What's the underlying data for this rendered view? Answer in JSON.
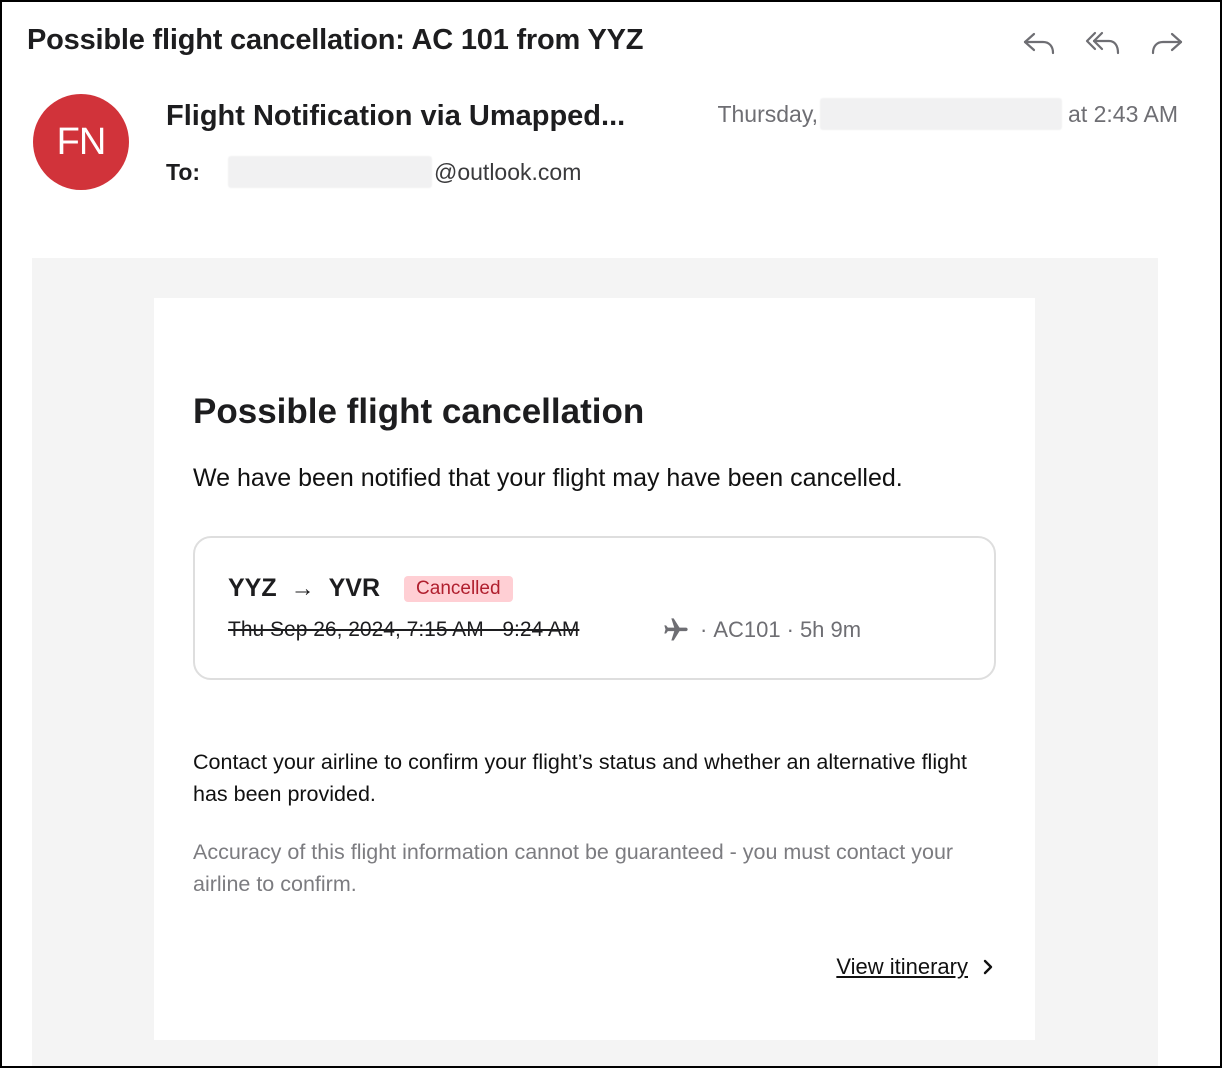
{
  "header": {
    "subject": "Possible flight cancellation: AC 101 from YYZ",
    "actions": {
      "reply": "reply-icon",
      "reply_all": "reply-all-icon",
      "forward": "forward-icon"
    }
  },
  "sender": {
    "initials": "FN",
    "avatar_color": "#d1333a",
    "name": "Flight Notification via Umapped...",
    "date_prefix": "Thursday,",
    "date_suffix": "at 2:43 AM"
  },
  "recipient": {
    "label": "To:",
    "address_domain": "@outlook.com"
  },
  "message": {
    "heading": "Possible flight cancellation",
    "notice": "We have been notified that your flight may have been cancelled.",
    "flight": {
      "origin": "YYZ",
      "arrow": "→",
      "destination": "YVR",
      "status": "Cancelled",
      "times": "Thu Sep 26, 2024, 7:15 AM - 9:24 AM",
      "airplane_icon": "airplane-icon",
      "separator": "·",
      "flight_number": "AC101",
      "duration": "5h 9m"
    },
    "contact": "Contact your airline to confirm your flight’s status and whether an alternative flight has been provided.",
    "disclaimer": "Accuracy of this flight information cannot be guaranteed - you must contact your airline to confirm.",
    "link_label": "View itinerary"
  },
  "colors": {
    "badge_bg": "#ffcfd4",
    "badge_text": "#b01f2e",
    "body_bg": "#f4f4f4"
  }
}
